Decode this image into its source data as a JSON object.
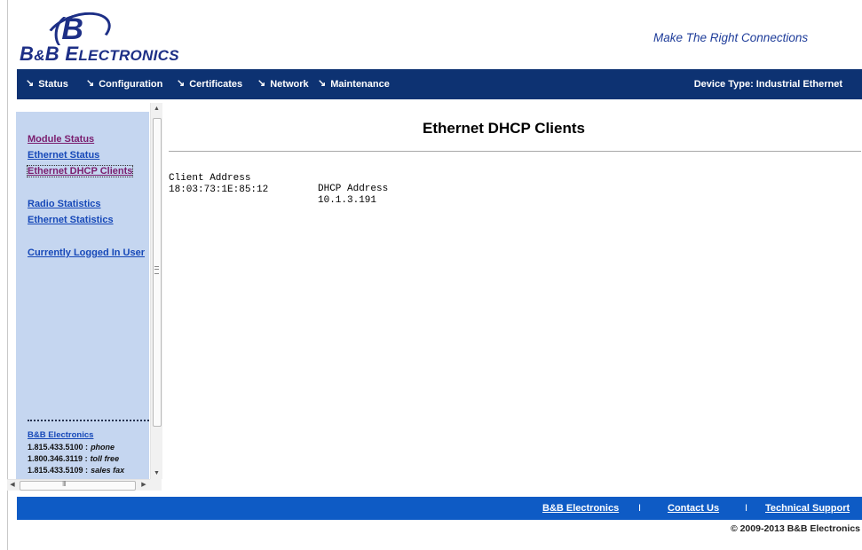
{
  "header": {
    "logo_mark": "B",
    "logo_text_big1": "B",
    "logo_text_amp": "&",
    "logo_text_big2": "B ",
    "logo_text_e": "E",
    "logo_text_rest": "LECTRONICS",
    "tagline": "Make The Right Connections"
  },
  "nav": {
    "items": [
      {
        "label": "Status"
      },
      {
        "label": "Configuration"
      },
      {
        "label": "Certificates"
      },
      {
        "label": "Network"
      },
      {
        "label": "Maintenance"
      }
    ],
    "device_type": "Device Type: Industrial Ethernet",
    "arrow": "↘"
  },
  "sidebar": {
    "links": [
      {
        "label": "Module Status"
      },
      {
        "label": "Ethernet Status"
      },
      {
        "label": "Ethernet DHCP Clients"
      },
      {
        "label": "Radio Statistics"
      },
      {
        "label": "Ethernet Statistics"
      },
      {
        "label": "Currently Logged In User"
      }
    ],
    "contact": {
      "title": "B&B Electronics",
      "lines": [
        {
          "number": "1.815.433.5100 :",
          "kind": "phone"
        },
        {
          "number": "1.800.346.3119 :",
          "kind": "toll free"
        },
        {
          "number": "1.815.433.5109 :",
          "kind": "sales fax"
        }
      ]
    },
    "scroll": {
      "grip_h": "III"
    }
  },
  "main": {
    "title": "Ethernet DHCP Clients",
    "table": {
      "headers": [
        "Client Address",
        "DHCP Address"
      ],
      "rows": [
        [
          "18:03:73:1E:85:12",
          "10.1.3.191"
        ]
      ]
    }
  },
  "footer": {
    "links": [
      {
        "label": "B&B Electronics"
      },
      {
        "label": "Contact Us"
      },
      {
        "label": "Technical Support"
      }
    ],
    "separator": "I",
    "copyright": "© 2009-2013 B&B Electronics"
  },
  "colors": {
    "nav_bg": "#0d3272",
    "footer_bg": "#0e5bc5",
    "sidebar_bg": "#c5d6f0",
    "brand": "#1d2f86",
    "link": "#1648b8",
    "visited_link": "#7a1d6e"
  }
}
